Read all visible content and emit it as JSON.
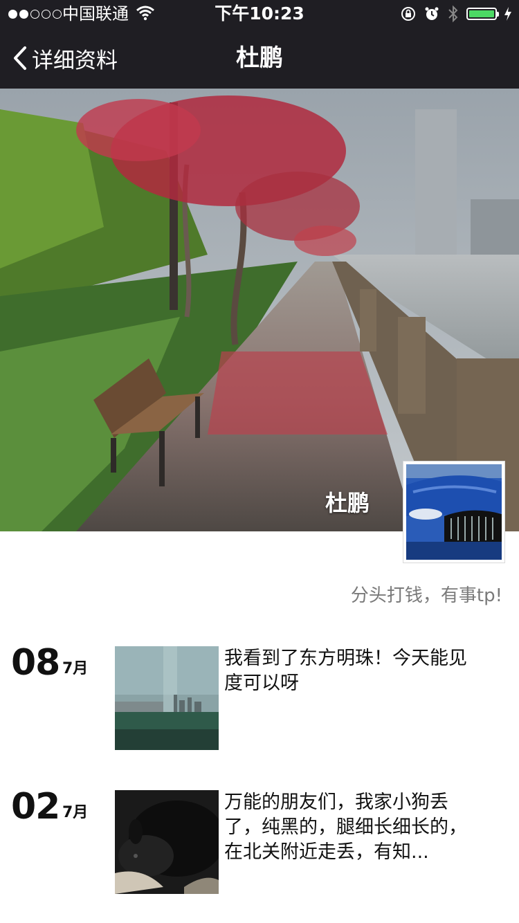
{
  "status_bar": {
    "carrier": "中国联通",
    "time": "下午10:23",
    "battery_level": 1.0,
    "signal_bars_filled": 2,
    "signal_bars_total": 5
  },
  "nav": {
    "back_label": "详细资料",
    "title": "杜鹏"
  },
  "profile": {
    "cover_name": "杜鹏",
    "signature": "分头打钱，有事tp!"
  },
  "posts": [
    {
      "day": "08",
      "month": "7月",
      "text": "我看到了东方明珠！今天能见度可以呀",
      "thumb": "city-skyline-photo"
    },
    {
      "day": "02",
      "month": "7月",
      "text": "万能的朋友们，我家小狗丢了，纯黑的，腿细长细长的，在北关附近走丢，有知...",
      "thumb": "black-puppy-photo"
    }
  ],
  "colors": {
    "nav_bg": "#1f1e23",
    "battery": "#4cd964",
    "signature": "#7a7a7a"
  }
}
